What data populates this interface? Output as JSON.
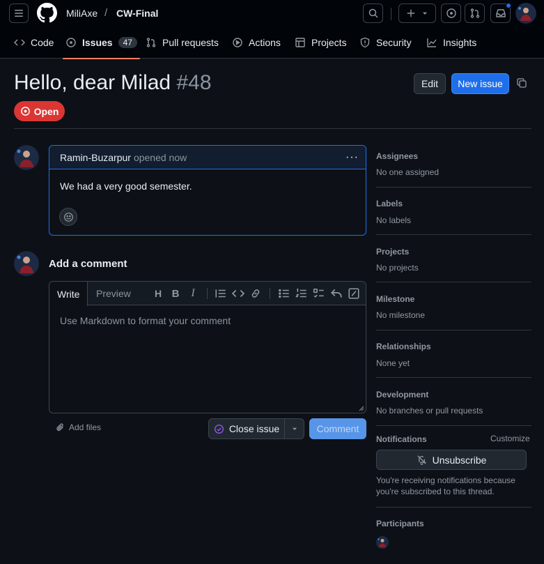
{
  "repo": {
    "owner": "MiliAxe",
    "separator": "/",
    "name": "CW-Final"
  },
  "icons": [
    "menu-icon",
    "github-logo-icon",
    "search-icon",
    "plus-icon",
    "chevron-down-icon",
    "issue-opened-icon",
    "pull-request-icon",
    "inbox-icon",
    "code-icon",
    "play-icon",
    "table-icon",
    "shield-icon",
    "graph-icon",
    "kebab-icon",
    "smiley-icon",
    "paperclip-icon",
    "check-circle-icon",
    "bell-slash-icon",
    "copy-icon"
  ],
  "colors": {
    "accent": "#1f6feb",
    "open": "#da3633",
    "tab_underline": "#f78166",
    "done": "#8957e5"
  },
  "tabs": [
    {
      "label": "Code"
    },
    {
      "label": "Issues",
      "count": "47"
    },
    {
      "label": "Pull requests"
    },
    {
      "label": "Actions"
    },
    {
      "label": "Projects"
    },
    {
      "label": "Security"
    },
    {
      "label": "Insights"
    }
  ],
  "issue": {
    "title": "Hello, dear Milad",
    "number": "#48",
    "state": "Open",
    "edit_label": "Edit",
    "new_issue_label": "New issue"
  },
  "comment": {
    "author": "Ramin-Buzarpur",
    "meta": "opened now",
    "body": "We had a very good semester."
  },
  "composer": {
    "heading": "Add a comment",
    "write_tab": "Write",
    "preview_tab": "Preview",
    "placeholder": "Use Markdown to format your comment",
    "add_files": "Add files",
    "close_issue": "Close issue",
    "comment_button": "Comment"
  },
  "sidebar": {
    "assignees": {
      "label": "Assignees",
      "value": "No one assigned"
    },
    "labels": {
      "label": "Labels",
      "value": "No labels"
    },
    "projects": {
      "label": "Projects",
      "value": "No projects"
    },
    "milestone": {
      "label": "Milestone",
      "value": "No milestone"
    },
    "relationships": {
      "label": "Relationships",
      "value": "None yet"
    },
    "development": {
      "label": "Development",
      "value": "No branches or pull requests"
    },
    "notifications": {
      "label": "Notifications",
      "customize": "Customize",
      "unsubscribe": "Unsubscribe",
      "notice": "You're receiving notifications because you're subscribed to this thread."
    },
    "participants": {
      "label": "Participants"
    }
  }
}
